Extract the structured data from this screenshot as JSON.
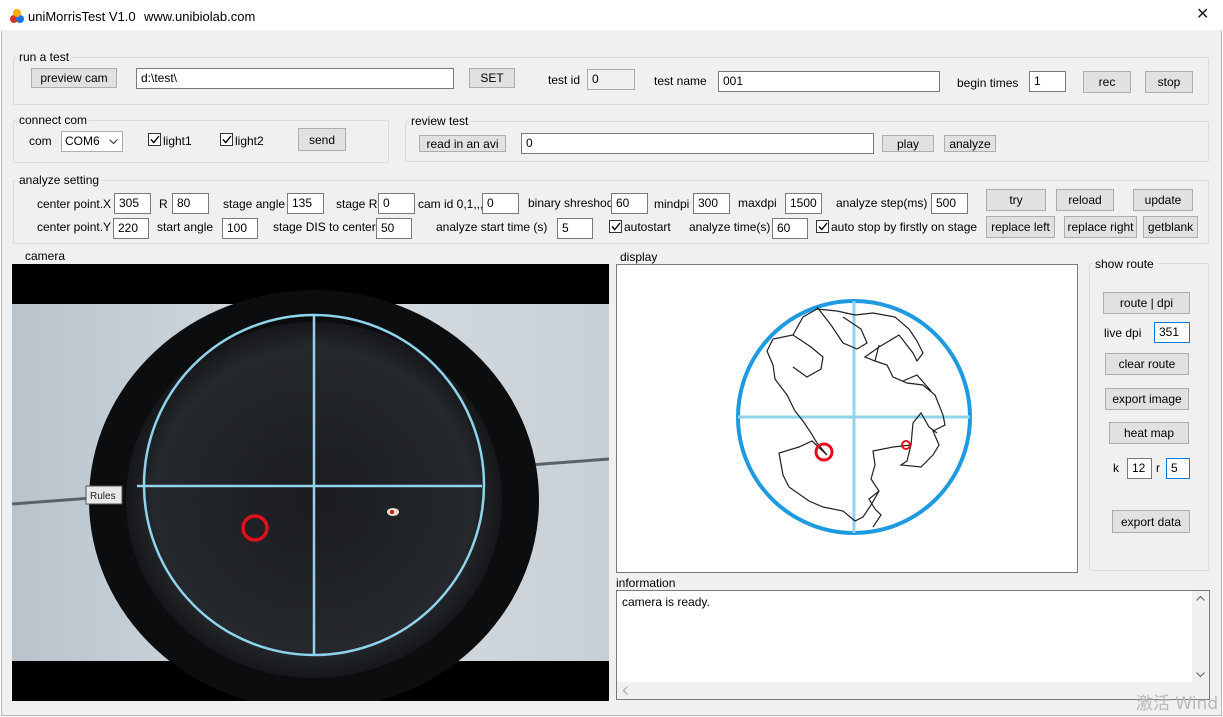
{
  "window": {
    "title": "uniMorrisTest V1.0",
    "website": "www.unibiolab.com",
    "close_glyph": "✕"
  },
  "run_test": {
    "group_label": "run a test",
    "preview_cam": "preview cam",
    "path_value": "d:\\test\\",
    "set_label": "SET",
    "test_id_label": "test id",
    "test_id_value": "0",
    "test_name_label": "test name",
    "test_name_value": "001",
    "begin_times_label": "begin times",
    "begin_times_value": "1",
    "rec_label": "rec",
    "stop_label": "stop"
  },
  "connect_com": {
    "group_label": "connect com",
    "com_label": "com",
    "com_value": "COM6",
    "light1": "light1",
    "light2": "light2",
    "send_label": "send"
  },
  "review_test": {
    "group_label": "review  test",
    "read_avi": "read in an avi",
    "avi_value": "0",
    "play_label": "play",
    "analyze_label": "analyze"
  },
  "analyze_setting": {
    "group_label": "analyze setting",
    "center_x_label": "center point.X",
    "center_x_value": "305",
    "r_label": "R",
    "r_value": "80",
    "stage_angle_label": "stage angle",
    "stage_angle_value": "135",
    "stage_r_label": "stage R",
    "stage_r_value": "0",
    "cam_id_label": "cam id 0,1,,,",
    "cam_id_value": "0",
    "binary_label": "binary shreshod",
    "binary_value": "60",
    "mindpi_label": "mindpi",
    "mindpi_value": "300",
    "maxdpi_label": "maxdpi",
    "maxdpi_value": "1500",
    "analyze_step_label": "analyze step(ms)",
    "analyze_step_value": "500",
    "center_y_label": "center point.Y",
    "center_y_value": "220",
    "start_angle_label": "start angle",
    "start_angle_value": "100",
    "stage_dis_label": "stage DIS to center",
    "stage_dis_value": "50",
    "analyze_start_label": "analyze start time (s)",
    "analyze_start_value": "5",
    "autostart_label": "autostart",
    "analyze_time_label": "analyze time(s)",
    "analyze_time_value": "60",
    "auto_stop_label": "auto stop by firstly on stage",
    "try_label": "try",
    "reload_label": "reload",
    "update_label": "update",
    "replace_left_label": "replace left",
    "replace_right_label": "replace right",
    "getblank_label": "getblank"
  },
  "camera": {
    "label": "camera",
    "sign_text": "Rules"
  },
  "display": {
    "label": "display"
  },
  "show_route": {
    "group_label": "show route",
    "route_dpi": "route | dpi",
    "live_dpi_label": "live dpi",
    "live_dpi_value": "351",
    "clear_route": "clear route",
    "export_image": "export image",
    "heat_map": "heat map",
    "k_label": "k",
    "k_value": "12",
    "r_label": "r",
    "r_value": "5",
    "export_data": "export data"
  },
  "information": {
    "label": "information",
    "text": "camera is ready."
  },
  "watermark": {
    "text": "激活 Wind"
  },
  "colors": {
    "circle_blue": "#1e9be0",
    "crosshair": "#8fd3ec",
    "marker_red": "#e0101c",
    "route_line": "#202020"
  }
}
